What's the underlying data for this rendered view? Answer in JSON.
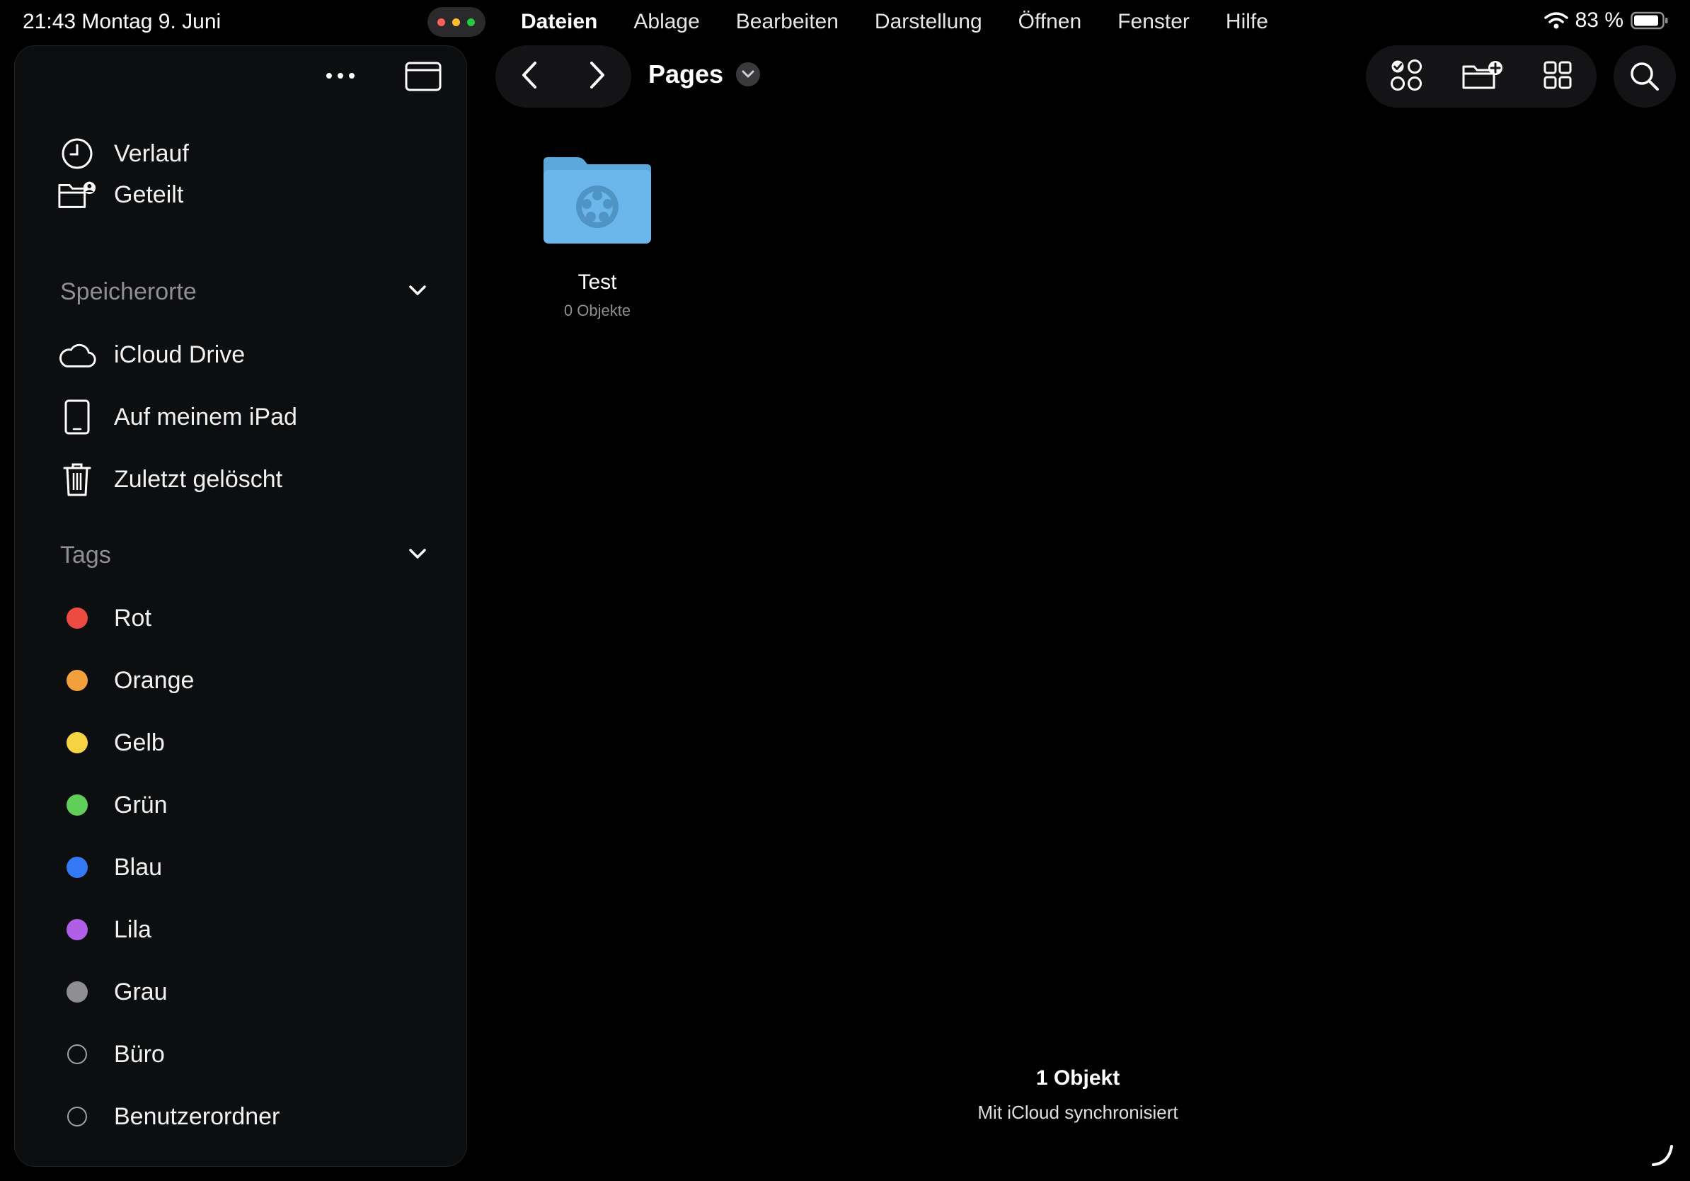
{
  "status": {
    "time_date": "21:43  Montag 9. Juni",
    "battery": "83 %"
  },
  "colors": {
    "red": "#eb4b40",
    "orange": "#f2a03c",
    "yellow": "#f8d443",
    "green": "#5fcf5a",
    "blue": "#3478f6",
    "purple": "#b15ee6",
    "gray": "#8e8e93",
    "folder": "#6bb6ea"
  },
  "menubar": [
    "Dateien",
    "Ablage",
    "Bearbeiten",
    "Darstellung",
    "Öffnen",
    "Fenster",
    "Hilfe"
  ],
  "sidebar": {
    "items": [
      {
        "label": "Verlauf",
        "icon": "clock-icon"
      },
      {
        "label": "Geteilt",
        "icon": "shared-folder-icon"
      }
    ],
    "locations_header": "Speicherorte",
    "locations": [
      {
        "label": "iCloud Drive",
        "icon": "cloud-icon"
      },
      {
        "label": "Auf meinem iPad",
        "icon": "ipad-icon"
      },
      {
        "label": "Zuletzt gelöscht",
        "icon": "trash-icon"
      }
    ],
    "tags_header": "Tags",
    "tags": [
      {
        "label": "Rot",
        "color": "#eb4b40"
      },
      {
        "label": "Orange",
        "color": "#f2a03c"
      },
      {
        "label": "Gelb",
        "color": "#f8d443"
      },
      {
        "label": "Grün",
        "color": "#5fcf5a"
      },
      {
        "label": "Blau",
        "color": "#3478f6"
      },
      {
        "label": "Lila",
        "color": "#b15ee6"
      },
      {
        "label": "Grau",
        "color": "#8e8e93"
      },
      {
        "label": "Büro",
        "color": ""
      },
      {
        "label": "Benutzerordner",
        "color": ""
      }
    ]
  },
  "toolbar": {
    "title": "Pages"
  },
  "content": {
    "folder": {
      "name": "Test",
      "meta": "0 Objekte",
      "icon": "pages-folder-icon"
    }
  },
  "footer": {
    "count": "1 Objekt",
    "sync": "Mit iCloud synchronisiert"
  }
}
